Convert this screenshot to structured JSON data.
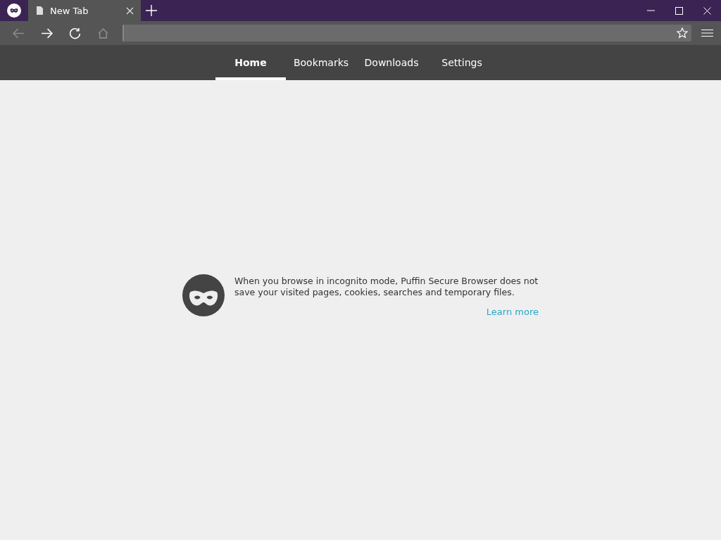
{
  "tab": {
    "title": "New Tab"
  },
  "toolbar": {
    "buttons": [
      {
        "kind": "back",
        "disabled": true
      },
      {
        "kind": "forward",
        "disabled": false
      },
      {
        "kind": "reload",
        "disabled": false
      },
      {
        "kind": "home",
        "disabled": true
      }
    ]
  },
  "nav_tabs": [
    {
      "label": "Home",
      "selected": true
    },
    {
      "label": "Bookmarks",
      "selected": false
    },
    {
      "label": "Downloads",
      "selected": false
    },
    {
      "label": "Settings",
      "selected": false
    }
  ],
  "notice": {
    "text": "When you browse in incognito mode, Puffin Secure Browser does not save your visited pages, cookies, searches and temporary files.",
    "link": "Learn more"
  }
}
